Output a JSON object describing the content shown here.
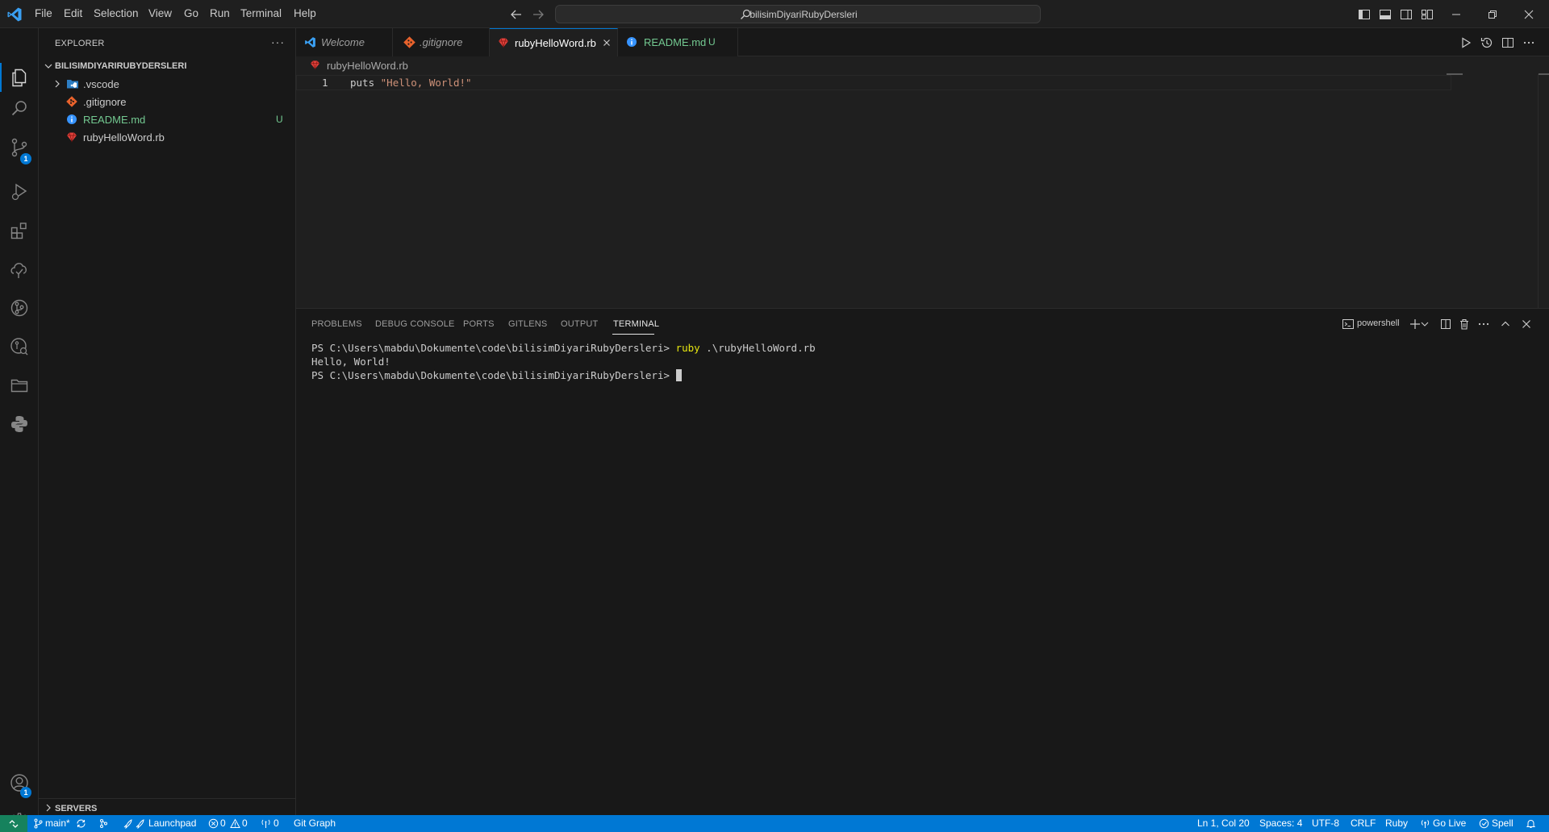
{
  "menu": [
    "File",
    "Edit",
    "Selection",
    "View",
    "Go",
    "Run",
    "Terminal",
    "Help"
  ],
  "command_center": {
    "text": "bilisimDiyariRubyDersleri"
  },
  "sidebar": {
    "title": "EXPLORER",
    "more": "···",
    "folder": "BILISIMDIYARIRUBYDERSLERI",
    "items": [
      {
        "label": ".vscode",
        "color": "#cccccc",
        "icon": "folder-vscode-icon"
      },
      {
        "label": ".gitignore",
        "color": "#cccccc",
        "icon": "git-icon"
      },
      {
        "label": "README.md",
        "color": "#73c991",
        "badge": "U",
        "icon": "info-icon"
      },
      {
        "label": "rubyHelloWord.rb",
        "color": "#cccccc",
        "icon": "ruby-icon"
      }
    ],
    "servers": "SERVERS"
  },
  "activity": {
    "source_control_badge": "1",
    "accounts_badge": "1"
  },
  "tabs": [
    {
      "label": "Welcome",
      "icon": "vscode-logo-icon"
    },
    {
      "label": ".gitignore",
      "icon": "git-icon"
    },
    {
      "label": "rubyHelloWord.rb",
      "icon": "ruby-icon",
      "active": true
    },
    {
      "label": "README.md",
      "badge": "U",
      "icon": "info-icon"
    }
  ],
  "breadcrumb": {
    "file": "rubyHelloWord.rb"
  },
  "editor": {
    "line_number": "1",
    "keyword": "puts",
    "string": "\"Hello, World!\""
  },
  "panel": {
    "tabs": [
      "PROBLEMS",
      "DEBUG CONSOLE",
      "PORTS",
      "GITLENS",
      "OUTPUT",
      "TERMINAL"
    ],
    "active_tab": "TERMINAL",
    "shell": "powershell"
  },
  "terminal": {
    "prompt": "PS C:\\Users\\mabdu\\Dokumente\\code\\bilisimDiyariRubyDersleri> ",
    "command": "ruby",
    "command_arg": " .\\rubyHelloWord.rb",
    "output": "Hello, World!"
  },
  "statusbar": {
    "branch": "main*",
    "launchpad": "Launchpad",
    "errors": "0",
    "warnings": "0",
    "ports": "0",
    "git_graph": "Git Graph",
    "cursor": "Ln 1, Col 20",
    "spaces": "Spaces: 4",
    "encoding": "UTF-8",
    "eol": "CRLF",
    "language": "Ruby",
    "golive": "Go Live",
    "spell": "Spell"
  },
  "colors": {
    "accent": "#0078d4",
    "remote": "#16825d",
    "ruby_red": "#e0413b",
    "git_orange": "#e8622c",
    "info_blue": "#3794ff",
    "untracked_green": "#73c991",
    "string_orange": "#ce9178",
    "keyword_yellow": "#e5e510"
  }
}
